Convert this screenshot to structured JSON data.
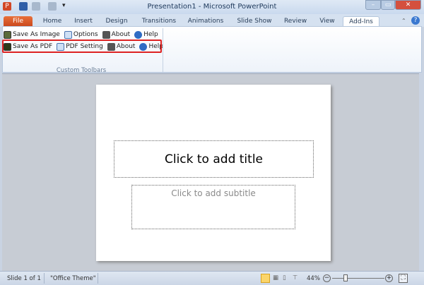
{
  "window": {
    "title": "Presentation1 - Microsoft PowerPoint",
    "minimize": "–",
    "maximize": "▭",
    "close": "✕"
  },
  "tabs": [
    "File",
    "Home",
    "Insert",
    "Design",
    "Transitions",
    "Animations",
    "Slide Show",
    "Review",
    "View",
    "Add-Ins"
  ],
  "ribbon": {
    "row1": [
      {
        "label": "Save As Image",
        "icon": "image-icon"
      },
      {
        "label": "Options",
        "icon": "table-icon"
      },
      {
        "label": "About",
        "icon": "speech-icon"
      },
      {
        "label": "Help",
        "icon": "help-icon"
      }
    ],
    "row2": [
      {
        "label": "Save As PDF",
        "icon": "save-pdf-icon"
      },
      {
        "label": "PDF Setting",
        "icon": "table-icon"
      },
      {
        "label": "About",
        "icon": "speech-icon"
      },
      {
        "label": "Help",
        "icon": "help-icon"
      }
    ],
    "group_label": "Custom Toolbars"
  },
  "slide": {
    "title_placeholder": "Click to add title",
    "subtitle_placeholder": "Click to add subtitle"
  },
  "status": {
    "slide": "Slide 1 of 1",
    "theme": "\"Office Theme\"",
    "zoom": "44%",
    "zoom_percent": 44
  }
}
